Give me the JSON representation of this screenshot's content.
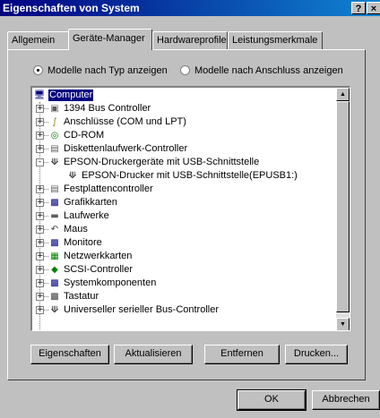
{
  "window": {
    "title": "Eigenschaften von System",
    "help_glyph": "?",
    "close_glyph": "×"
  },
  "tabs": [
    {
      "label": "Allgemein",
      "active": false
    },
    {
      "label": "Geräte-Manager",
      "active": true
    },
    {
      "label": "Hardwareprofile",
      "active": false
    },
    {
      "label": "Leistungsmerkmale",
      "active": false
    }
  ],
  "view_options": {
    "by_type": {
      "label": "Modelle nach Typ anzeigen",
      "selected": true
    },
    "by_connection": {
      "label": "Modelle nach Anschluss anzeigen",
      "selected": false
    }
  },
  "tree": {
    "root": {
      "label": "Computer",
      "icon": "computer-icon",
      "selected": true
    },
    "items": [
      {
        "label": "1394 Bus Controller",
        "icon": "bus-controller-icon",
        "expander": "+"
      },
      {
        "label": "Anschlüsse (COM und LPT)",
        "icon": "port-icon",
        "expander": "+"
      },
      {
        "label": "CD-ROM",
        "icon": "cdrom-icon",
        "expander": "+"
      },
      {
        "label": "Diskettenlaufwerk-Controller",
        "icon": "floppy-controller-icon",
        "expander": "+"
      },
      {
        "label": "EPSON-Druckergeräte mit USB-Schnittstelle",
        "icon": "usb-icon",
        "expander": "-"
      },
      {
        "label": "EPSON-Drucker mit USB-Schnittstelle(EPUSB1:)",
        "icon": "usb-icon",
        "expander": "",
        "child": true
      },
      {
        "label": "Festplattencontroller",
        "icon": "disk-controller-icon",
        "expander": "+"
      },
      {
        "label": "Grafikkarten",
        "icon": "display-adapter-icon",
        "expander": "+"
      },
      {
        "label": "Laufwerke",
        "icon": "drive-icon",
        "expander": "+"
      },
      {
        "label": "Maus",
        "icon": "mouse-icon",
        "expander": "+"
      },
      {
        "label": "Monitore",
        "icon": "monitor-icon",
        "expander": "+"
      },
      {
        "label": "Netzwerkkarten",
        "icon": "network-card-icon",
        "expander": "+"
      },
      {
        "label": "SCSI-Controller",
        "icon": "scsi-icon",
        "expander": "+"
      },
      {
        "label": "Systemkomponenten",
        "icon": "system-icon",
        "expander": "+"
      },
      {
        "label": "Tastatur",
        "icon": "keyboard-icon",
        "expander": "+"
      },
      {
        "label": "Universeller serieller Bus-Controller",
        "icon": "usb-controller-icon",
        "expander": "+"
      }
    ]
  },
  "action_buttons": {
    "properties": "Eigenschaften",
    "refresh": "Aktualisieren",
    "remove": "Entfernen",
    "print": "Drucken..."
  },
  "dialog_buttons": {
    "ok": "OK",
    "cancel": "Abbrechen"
  }
}
